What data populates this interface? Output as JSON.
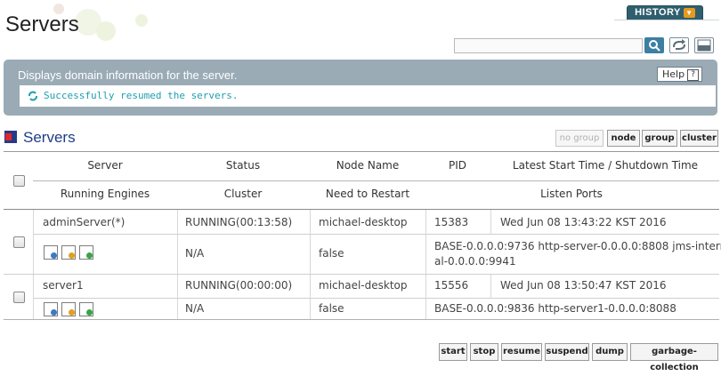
{
  "header": {
    "title": "Servers",
    "history_label": "HISTORY",
    "search": {
      "value": "",
      "placeholder": ""
    }
  },
  "info": {
    "description": "Displays domain information for the server.",
    "help_label": "Help",
    "help_glyph": "?",
    "message": "Successfully resumed the servers."
  },
  "section": {
    "title": "Servers",
    "group_buttons": [
      "no group",
      "node",
      "group",
      "cluster"
    ]
  },
  "table": {
    "headers_top": [
      "Server",
      "Status",
      "Node Name",
      "PID",
      "Latest Start Time / Shutdown Time"
    ],
    "headers_bottom": [
      "Running Engines",
      "Cluster",
      "Need to Restart",
      "Listen Ports"
    ],
    "rows": [
      {
        "server": "adminServer(*)",
        "status": "RUNNING(00:13:58)",
        "node": "michael-desktop",
        "pid": "15383",
        "time": "Wed Jun 08 13:43:22 KST 2016",
        "cluster": "N/A",
        "restart": "false",
        "ports_line1": "BASE-0.0.0.0:9736 http-server-0.0.0.0:8808 jms-intern",
        "ports_line2": "al-0.0.0.0:9941"
      },
      {
        "server": "server1",
        "status": "RUNNING(00:00:00)",
        "node": "michael-desktop",
        "pid": "15556",
        "time": "Wed Jun 08 13:50:47 KST 2016",
        "cluster": "N/A",
        "restart": "false",
        "ports_line1": "BASE-0.0.0.0:9836 http-server1-0.0.0.0:8088",
        "ports_line2": ""
      }
    ]
  },
  "actions": [
    "start",
    "stop",
    "resume",
    "suspend",
    "dump",
    "garbage-collection"
  ],
  "colors": {
    "accent": "#2f5f6e",
    "panel": "#9aabb6",
    "message": "#1d9fb0",
    "section_title": "#1f3c86"
  },
  "icons": [
    "search-icon",
    "refresh-icon",
    "xml-export-icon",
    "resume-icon",
    "servers-section-icon",
    "engine-icon"
  ]
}
